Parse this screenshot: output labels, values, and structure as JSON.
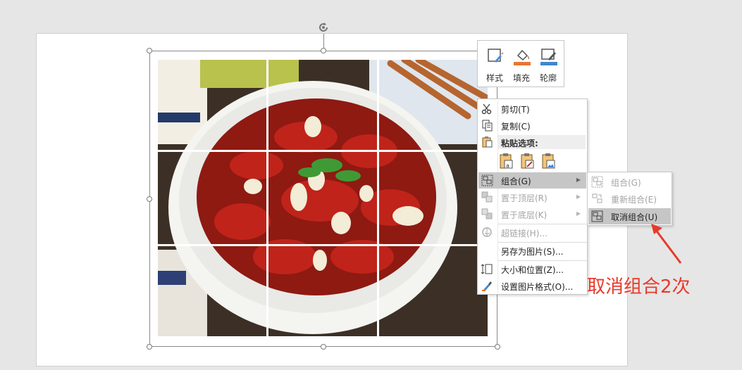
{
  "mini_toolbar": {
    "buttons": [
      {
        "label": "样式",
        "icon": "shape-style-icon"
      },
      {
        "label": "填充",
        "icon": "fill-bucket-icon",
        "color": "#e8772e"
      },
      {
        "label": "轮廓",
        "icon": "outline-pen-icon",
        "color": "#3f86d0"
      }
    ]
  },
  "context_menu": {
    "cut": "剪切(T)",
    "copy": "复制(C)",
    "paste_header": "粘贴选项:",
    "group": "组合(G)",
    "bring_front": "置于顶层(R)",
    "send_back": "置于底层(K)",
    "hyperlink": "超链接(H)...",
    "save_as_picture": "另存为图片(S)...",
    "size_position": "大小和位置(Z)...",
    "format_picture": "设置图片格式(O)..."
  },
  "submenu": {
    "group": "组合(G)",
    "regroup": "重新组合(E)",
    "ungroup": "取消组合(U)"
  },
  "annotation": {
    "text": "取消组合2次",
    "color": "#e8392a"
  },
  "colors": {
    "highlight": "#c6c6c6",
    "disabled_text": "#a3a3a3"
  }
}
